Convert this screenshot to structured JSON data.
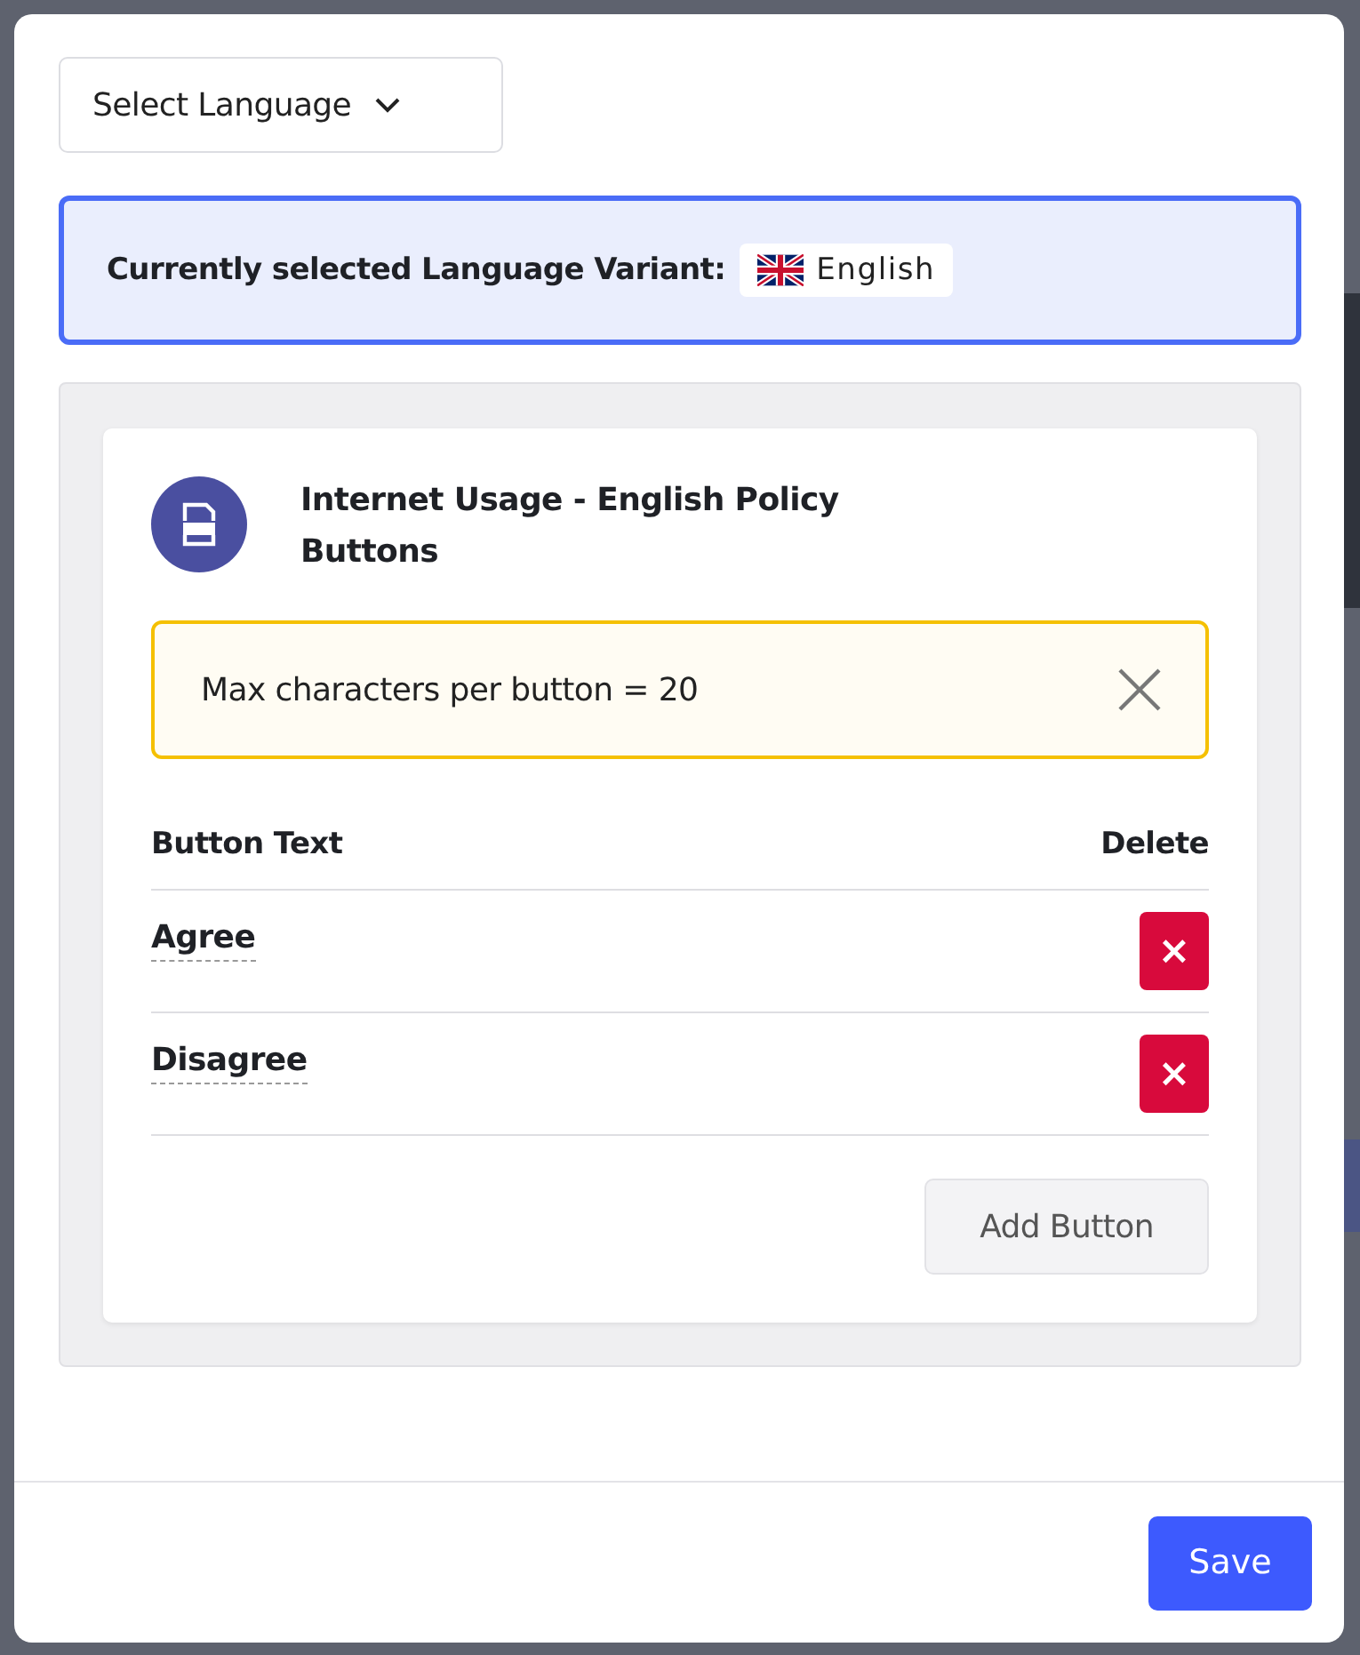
{
  "language_dropdown": {
    "label": "Select Language"
  },
  "current_variant": {
    "label": "Currently selected Language Variant:",
    "language": "English"
  },
  "policy": {
    "title": "Internet Usage - English Policy",
    "subtitle": "Buttons"
  },
  "alert": {
    "text": "Max characters per button = 20"
  },
  "table": {
    "columns": [
      "Button Text",
      "Delete"
    ],
    "rows": [
      {
        "text": "Agree",
        "delete": "×"
      },
      {
        "text": "Disagree",
        "delete": "×"
      }
    ]
  },
  "add_button": "Add Button",
  "footer": {
    "save": "Save"
  }
}
